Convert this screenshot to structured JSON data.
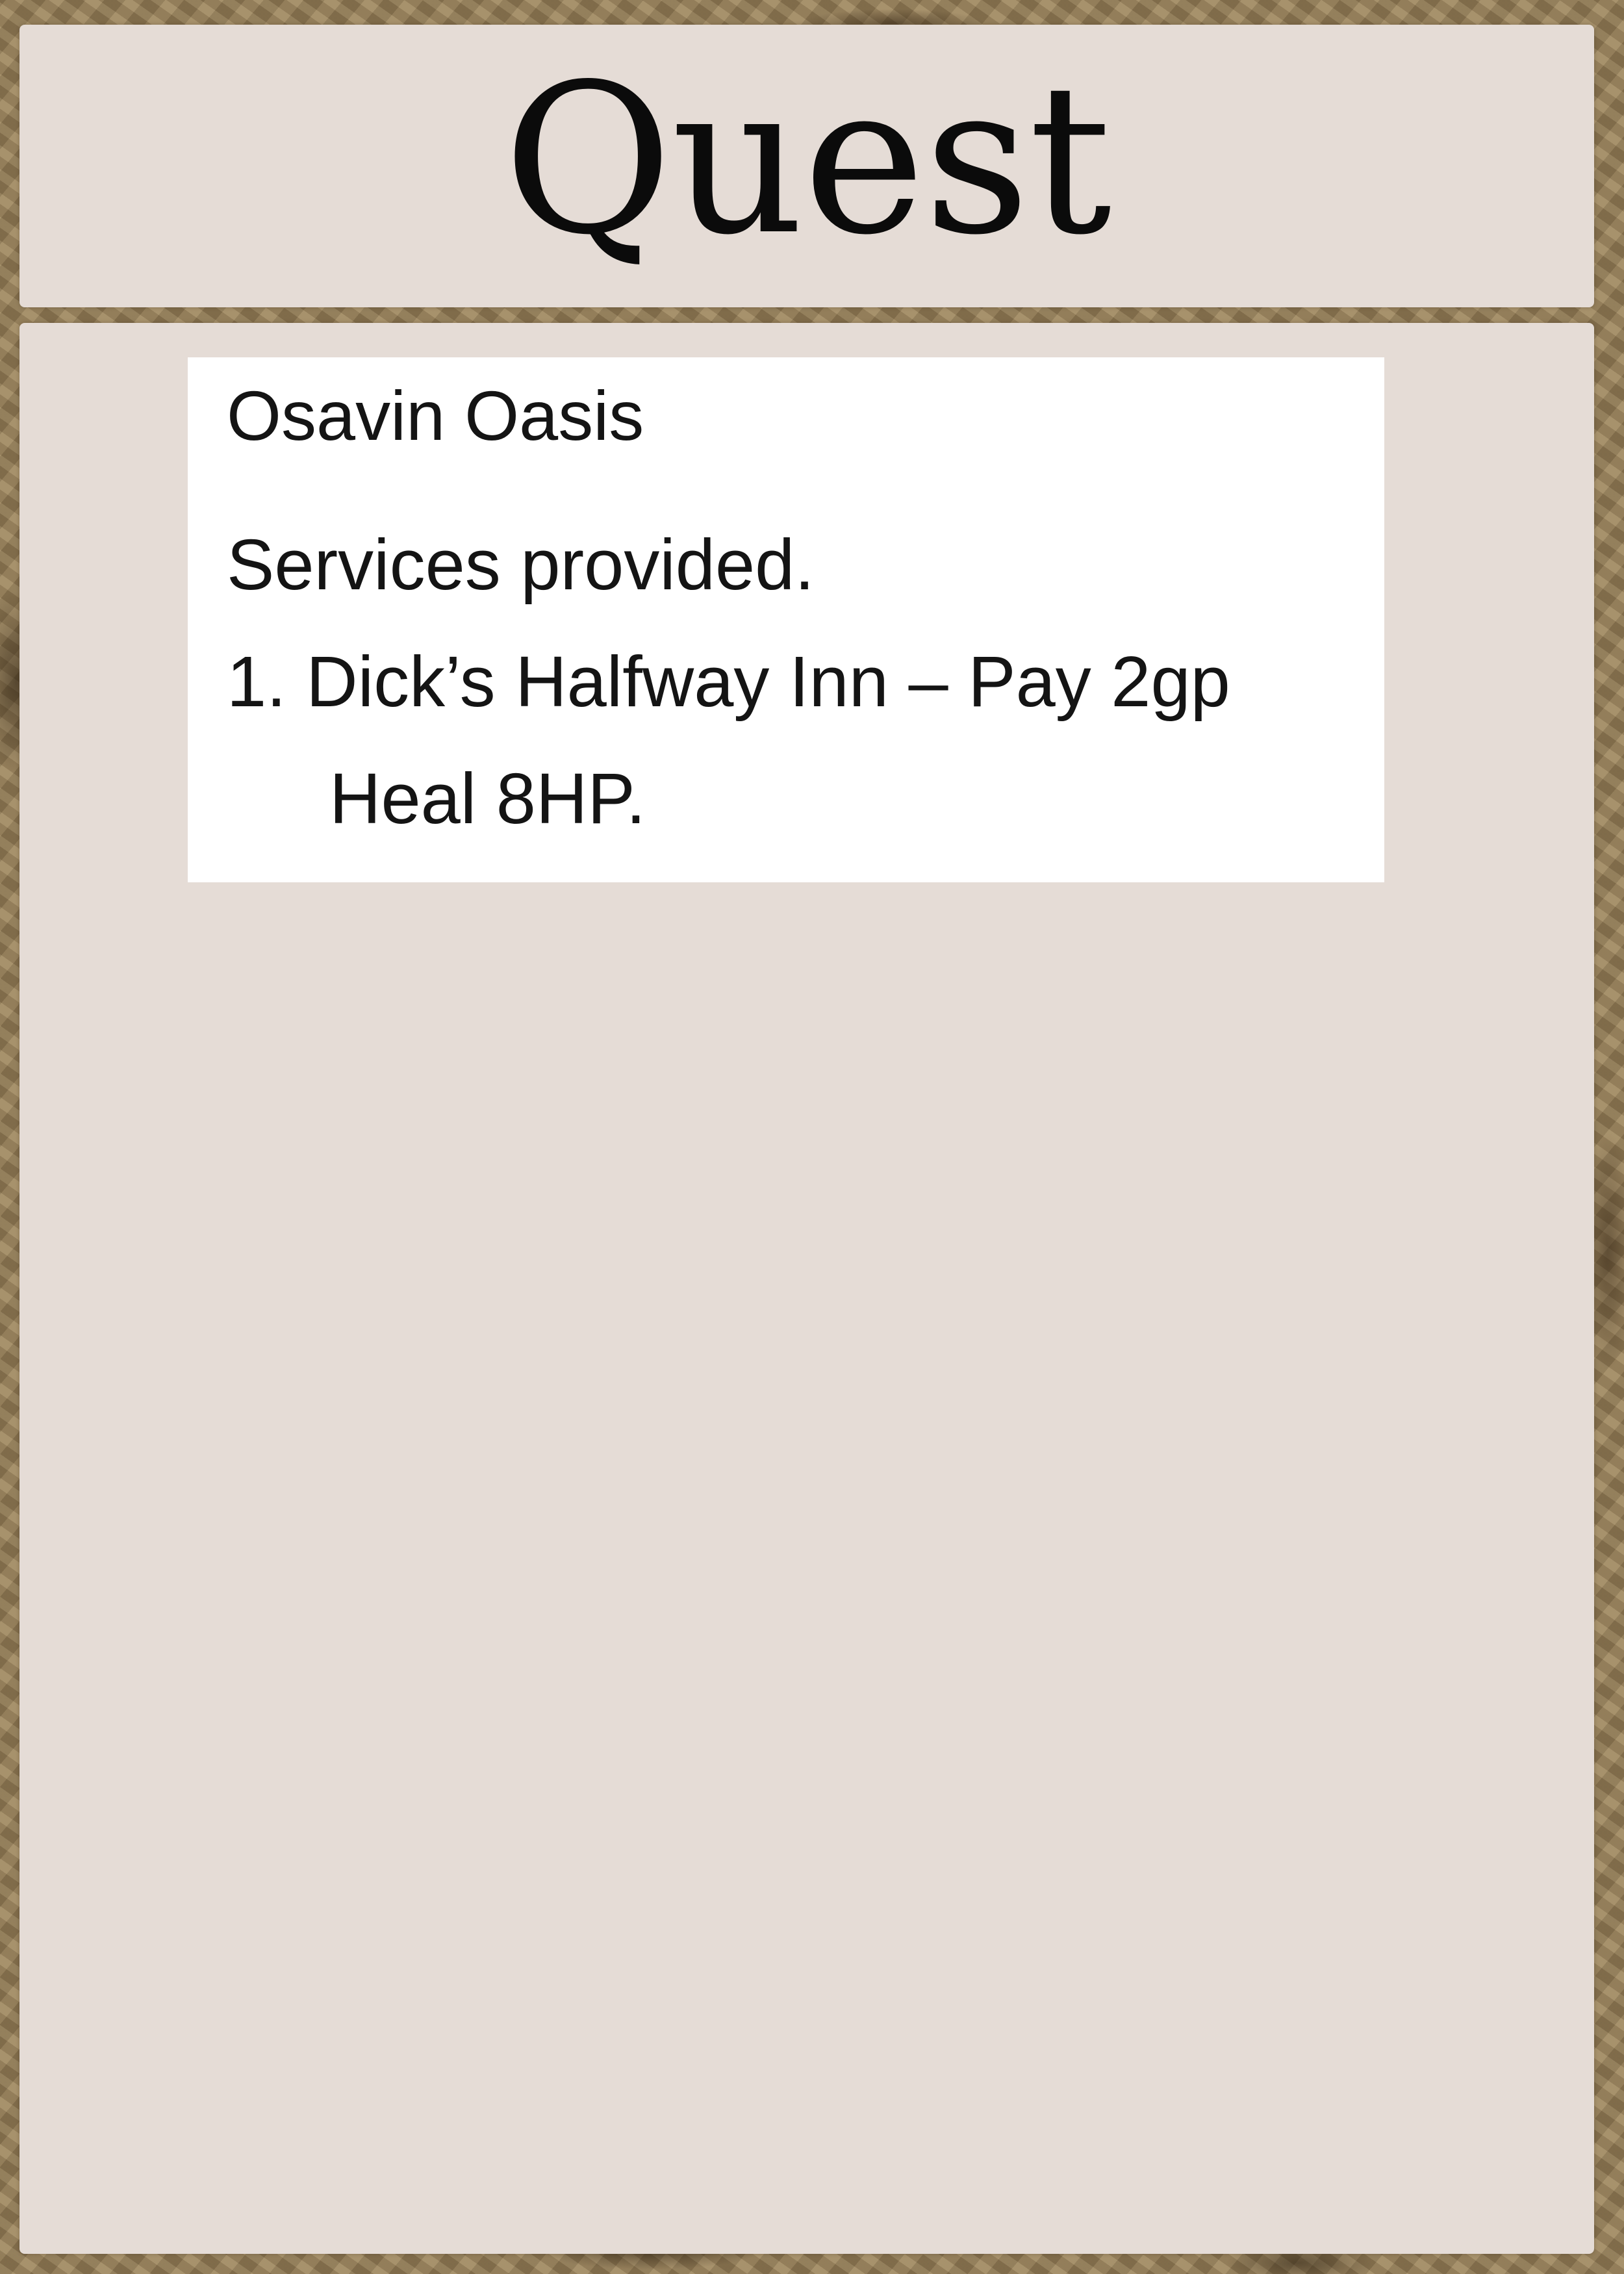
{
  "card": {
    "title": "Quest",
    "note": {
      "location": "Osavin Oasis",
      "services_heading": "Services provided.",
      "services": [
        {
          "name": "1. Dick’s Halfway Inn – Pay 2gp",
          "effect": "Heal 8HP."
        }
      ]
    }
  },
  "colors": {
    "border_texture": "#8f7a57",
    "panel": "#e5dcd6",
    "note_background": "#ffffff",
    "text": "#141414"
  }
}
